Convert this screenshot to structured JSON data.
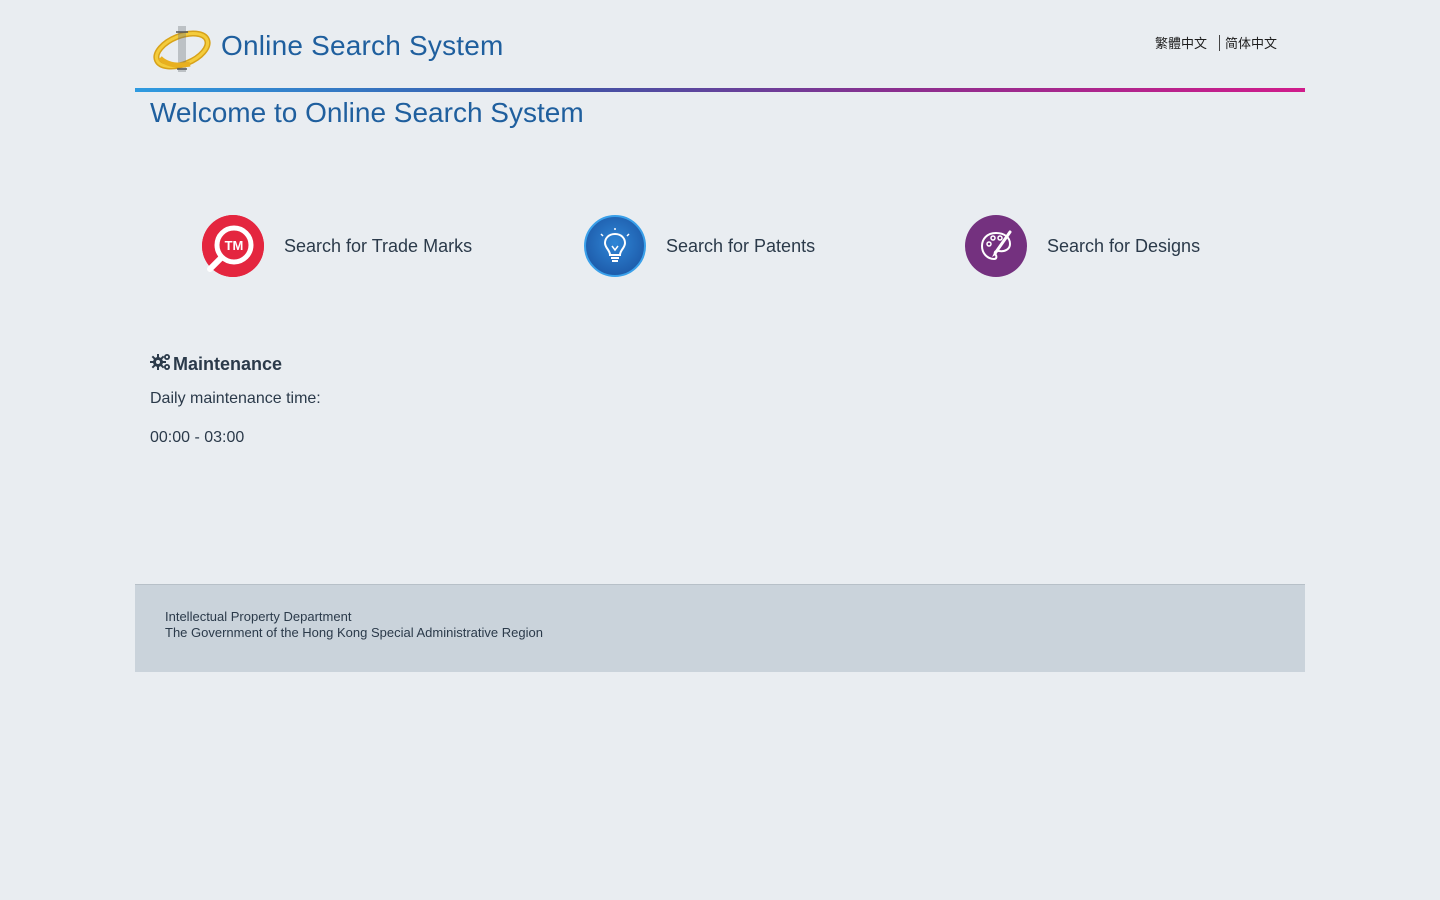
{
  "header": {
    "site_title": "Online Search System",
    "logo_icon": "ipd-ring-logo-icon",
    "languages": [
      "繁體中文",
      "简体中文"
    ]
  },
  "welcome": "Welcome to Online Search System",
  "options": [
    {
      "label": "Search for Trade Marks",
      "icon": "trade-mark-search-icon",
      "color": "#e4263f"
    },
    {
      "label": "Search for Patents",
      "icon": "lightbulb-icon",
      "color": "#1f5fae"
    },
    {
      "label": "Search for Designs",
      "icon": "palette-brush-icon",
      "color": "#74317f"
    }
  ],
  "maintenance": {
    "title": "Maintenance",
    "icon": "gears-icon",
    "line1": "Daily maintenance time:",
    "line2": "00:00 - 03:00"
  },
  "footer": {
    "line1": "Intellectual Property Department",
    "line2": "The Government of the Hong Kong Special Administrative Region"
  },
  "colors": {
    "background": "#e9edf1",
    "title_blue": "#1f5f9e",
    "footer_bg": "#cad3db"
  }
}
